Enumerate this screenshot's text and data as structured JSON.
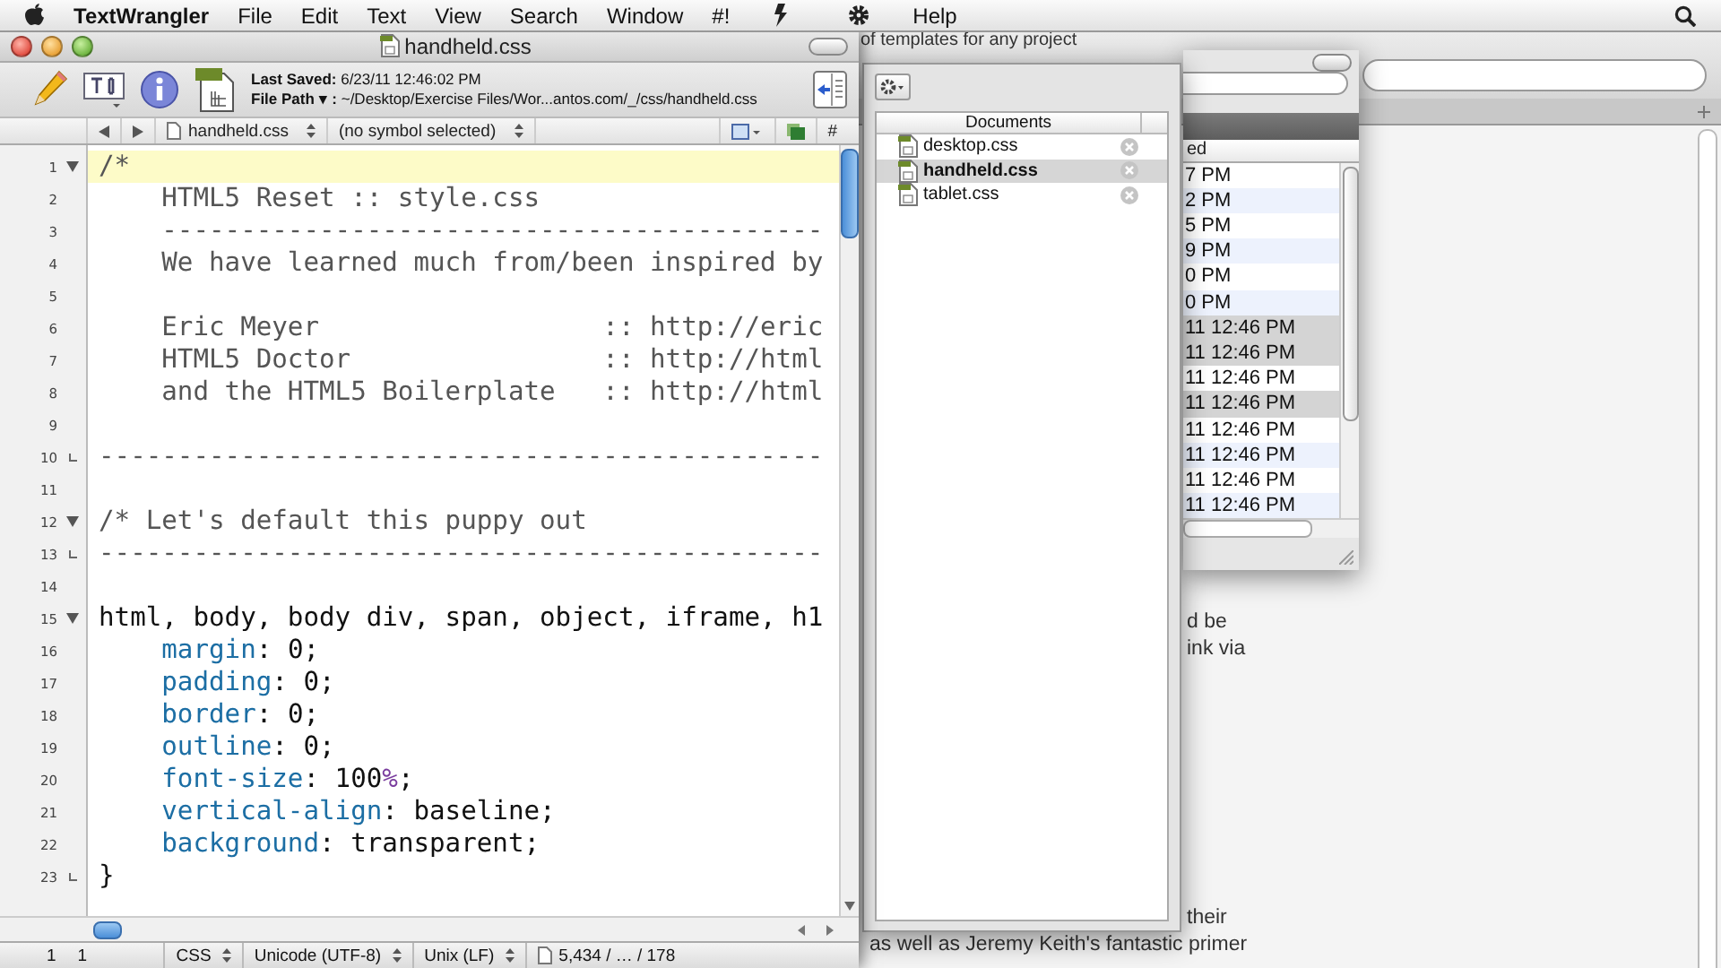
{
  "menu_bar": {
    "app_name": "TextWrangler",
    "items": [
      "File",
      "Edit",
      "Text",
      "View",
      "Search",
      "Window",
      "#!",
      "Help"
    ]
  },
  "browser": {
    "top_text": "of templates for any project",
    "right_fragments": [
      "d be",
      "ink via"
    ],
    "lower_fragment": "their",
    "bottom_line": "as well as Jeremy Keith's fantastic primer"
  },
  "file_browser": {
    "column": "ed",
    "rows": [
      {
        "text": "7 PM",
        "selected": false
      },
      {
        "text": "2 PM",
        "selected": false
      },
      {
        "text": "5 PM",
        "selected": false
      },
      {
        "text": "9 PM",
        "selected": false
      },
      {
        "text": "0 PM",
        "selected": false
      },
      {
        "text": "0 PM",
        "selected": false
      },
      {
        "text": "11 12:46 PM",
        "selected": true
      },
      {
        "text": "11 12:46 PM",
        "selected": true
      },
      {
        "text": "11 12:46 PM",
        "selected": false
      },
      {
        "text": "11 12:46 PM",
        "selected": true
      },
      {
        "text": "11 12:46 PM",
        "selected": false
      },
      {
        "text": "11 12:46 PM",
        "selected": false
      },
      {
        "text": "11 12:46 PM",
        "selected": false
      },
      {
        "text": "11 12:46 PM",
        "selected": false
      }
    ]
  },
  "documents_drawer": {
    "column": "Documents",
    "items": [
      {
        "name": "desktop.css",
        "selected": false
      },
      {
        "name": "handheld.css",
        "selected": true
      },
      {
        "name": "tablet.css",
        "selected": false
      }
    ]
  },
  "editor_window": {
    "title": "handheld.css",
    "last_saved_label": "Last Saved:",
    "last_saved": "6/23/11 12:46:02 PM",
    "file_path_label": "File Path ▾ :",
    "file_path": "~/Desktop/Exercise Files/Wor...antos.com/_/css/handheld.css",
    "file_popup": "handheld.css",
    "symbol_popup": "(no symbol selected)",
    "hash_menu": "#",
    "lines": [
      {
        "number": "1",
        "fold_start": true,
        "fold_end": false,
        "current": true,
        "segments": [
          {
            "text": "/*",
            "kind": "comment"
          }
        ]
      },
      {
        "number": "2",
        "fold_start": false,
        "fold_end": false,
        "current": false,
        "segments": [
          {
            "text": "    HTML5 Reset :: style.css",
            "kind": "comment"
          }
        ]
      },
      {
        "number": "3",
        "fold_start": false,
        "fold_end": false,
        "current": false,
        "segments": [
          {
            "text": "    ------------------------------------------",
            "kind": "comment"
          }
        ]
      },
      {
        "number": "4",
        "fold_start": false,
        "fold_end": false,
        "current": false,
        "segments": [
          {
            "text": "    We have learned much from/been inspired by",
            "kind": "comment"
          }
        ]
      },
      {
        "number": "5",
        "fold_start": false,
        "fold_end": false,
        "current": false
      },
      {
        "number": "6",
        "fold_start": false,
        "fold_end": false,
        "current": false,
        "segments": [
          {
            "text": "    Eric Meyer                  :: http://eric",
            "kind": "comment"
          }
        ]
      },
      {
        "number": "7",
        "fold_start": false,
        "fold_end": false,
        "current": false,
        "segments": [
          {
            "text": "    HTML5 Doctor                :: http://html",
            "kind": "comment"
          }
        ]
      },
      {
        "number": "8",
        "fold_start": false,
        "fold_end": false,
        "current": false,
        "segments": [
          {
            "text": "    and the HTML5 Boilerplate   :: http://html",
            "kind": "comment"
          }
        ]
      },
      {
        "number": "9",
        "fold_start": false,
        "fold_end": false,
        "current": false
      },
      {
        "number": "10",
        "fold_start": false,
        "fold_end": true,
        "current": false,
        "segments": [
          {
            "text": "----------------------------------------------",
            "kind": "comment"
          }
        ]
      },
      {
        "number": "11",
        "fold_start": false,
        "fold_end": false,
        "current": false
      },
      {
        "number": "12",
        "fold_start": true,
        "fold_end": false,
        "current": false,
        "segments": [
          {
            "text": "/* Let's default this puppy out",
            "kind": "comment"
          }
        ]
      },
      {
        "number": "13",
        "fold_start": false,
        "fold_end": true,
        "current": false,
        "segments": [
          {
            "text": "----------------------------------------------",
            "kind": "comment"
          }
        ]
      },
      {
        "number": "14",
        "fold_start": false,
        "fold_end": false,
        "current": false
      },
      {
        "number": "15",
        "fold_start": true,
        "fold_end": false,
        "current": false,
        "segments": [
          {
            "text": "html, body, body div, span, object, iframe, h1",
            "kind": "plain"
          }
        ]
      },
      {
        "number": "16",
        "fold_start": false,
        "fold_end": false,
        "current": false,
        "segments": [
          {
            "text": "    margin",
            "kind": "property"
          },
          {
            "text": ": 0;",
            "kind": "plain"
          }
        ]
      },
      {
        "number": "17",
        "fold_start": false,
        "fold_end": false,
        "current": false,
        "segments": [
          {
            "text": "    padding",
            "kind": "property"
          },
          {
            "text": ": 0;",
            "kind": "plain"
          }
        ]
      },
      {
        "number": "18",
        "fold_start": false,
        "fold_end": false,
        "current": false,
        "segments": [
          {
            "text": "    border",
            "kind": "property"
          },
          {
            "text": ": 0;",
            "kind": "plain"
          }
        ]
      },
      {
        "number": "19",
        "fold_start": false,
        "fold_end": false,
        "current": false,
        "segments": [
          {
            "text": "    outline",
            "kind": "property"
          },
          {
            "text": ": 0;",
            "kind": "plain"
          }
        ]
      },
      {
        "number": "20",
        "fold_start": false,
        "fold_end": false,
        "current": false,
        "segments": [
          {
            "text": "    font-size",
            "kind": "property"
          },
          {
            "text": ": 100",
            "kind": "plain"
          },
          {
            "text": "%",
            "kind": "unit"
          },
          {
            "text": ";",
            "kind": "plain"
          }
        ]
      },
      {
        "number": "21",
        "fold_start": false,
        "fold_end": false,
        "current": false,
        "segments": [
          {
            "text": "    vertical-align",
            "kind": "property"
          },
          {
            "text": ": baseline;",
            "kind": "plain"
          }
        ]
      },
      {
        "number": "22",
        "fold_start": false,
        "fold_end": false,
        "current": false,
        "segments": [
          {
            "text": "    background",
            "kind": "property"
          },
          {
            "text": ": transparent;",
            "kind": "plain"
          }
        ]
      },
      {
        "number": "23",
        "fold_start": false,
        "fold_end": true,
        "current": false,
        "segments": [
          {
            "text": "}",
            "kind": "plain"
          }
        ]
      }
    ],
    "status": {
      "line": "1",
      "column": "1",
      "language": "CSS",
      "encoding": "Unicode (UTF-8)",
      "line_endings": "Unix (LF)",
      "stats": "5,434 / … / 178"
    }
  }
}
